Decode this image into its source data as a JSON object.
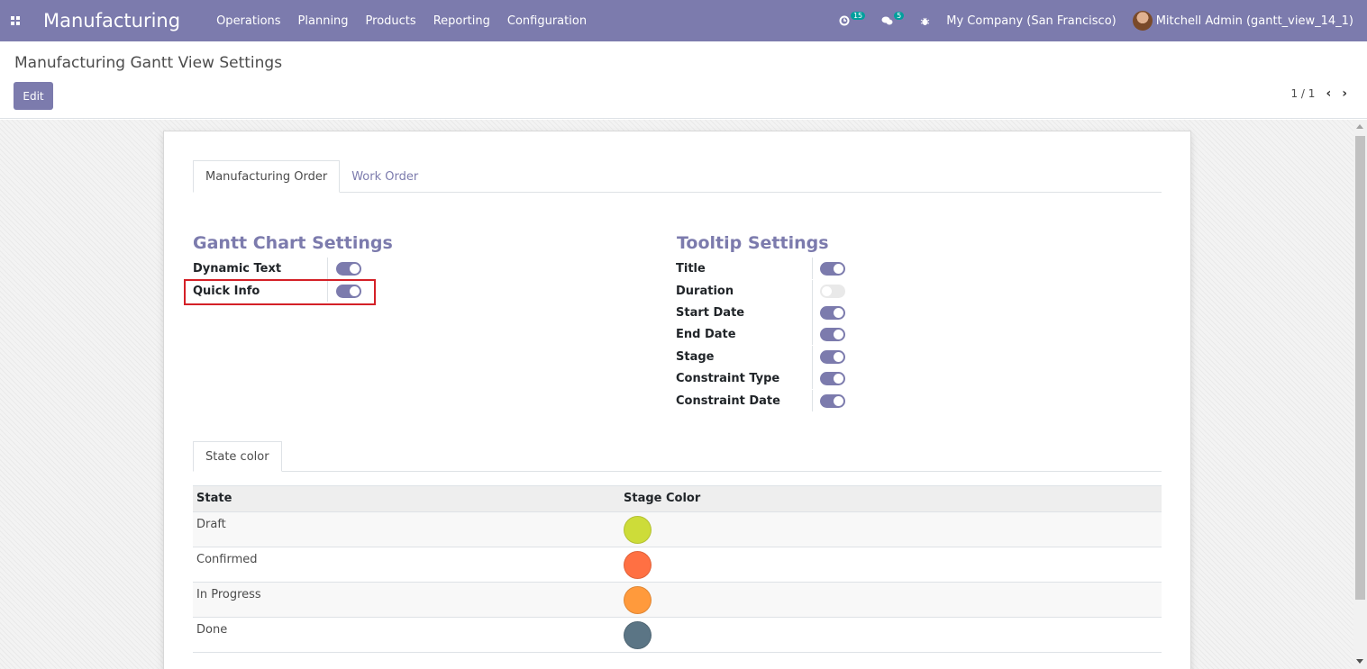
{
  "navbar": {
    "app_title": "Manufacturing",
    "menu": [
      "Operations",
      "Planning",
      "Products",
      "Reporting",
      "Configuration"
    ],
    "activity_badge": "15",
    "messages_badge": "5",
    "company": "My Company (San Francisco)",
    "user": "Mitchell Admin (gantt_view_14_1)"
  },
  "control_panel": {
    "breadcrumb": "Manufacturing Gantt View Settings",
    "edit_label": "Edit",
    "pager": "1 / 1",
    "prev": "‹",
    "next": "›"
  },
  "tabs": [
    {
      "label": "Manufacturing Order",
      "active": true
    },
    {
      "label": "Work Order",
      "active": false
    }
  ],
  "gantt_settings": {
    "title": "Gantt Chart Settings",
    "fields": [
      {
        "label": "Dynamic Text",
        "enabled": true
      },
      {
        "label": "Quick Info",
        "enabled": true
      }
    ]
  },
  "tooltip_settings": {
    "title": "Tooltip Settings",
    "fields": [
      {
        "label": "Title",
        "enabled": true
      },
      {
        "label": "Duration",
        "enabled": false
      },
      {
        "label": "Start Date",
        "enabled": true
      },
      {
        "label": "End Date",
        "enabled": true
      },
      {
        "label": "Stage",
        "enabled": true
      },
      {
        "label": "Constraint Type",
        "enabled": true
      },
      {
        "label": "Constraint Date",
        "enabled": true
      }
    ]
  },
  "state_color_tab": "State color",
  "state_table": {
    "headers": [
      "State",
      "Stage Color"
    ],
    "rows": [
      {
        "state": "Draft",
        "color": "#cddc39"
      },
      {
        "state": "Confirmed",
        "color": "#ff7043"
      },
      {
        "state": "In Progress",
        "color": "#ff9a3c"
      },
      {
        "state": "Done",
        "color": "#5b7585"
      }
    ]
  },
  "colors": {
    "brand": "#7c7bad",
    "highlight": "#d42027"
  }
}
